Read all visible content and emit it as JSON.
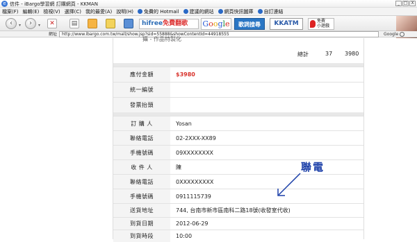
{
  "window": {
    "title": "信件 - iBargo學習網 訂購網頁 - KKMAN",
    "buttons": [
      "_",
      "□",
      "X"
    ]
  },
  "menubar": {
    "items": [
      "檔案(F)",
      "編輯(E)",
      "檢視(V)",
      "選擇(C)",
      "我的最愛(A)",
      "說明(H)"
    ],
    "links": [
      "免費的 Hotmail",
      "建議的網站",
      "網頁快訊圖庫",
      "自訂連結"
    ]
  },
  "toolbar": {
    "hifree_prefix": "hifree",
    "hifree_suffix": "免費翻歌",
    "google": [
      "G",
      "o",
      "o",
      "g",
      "l",
      "e"
    ],
    "kkbox": "歌詞搜尋",
    "kkatm": "KKATM",
    "game_line1": "免費",
    "game_line2": "小遊戲"
  },
  "address": {
    "label": "網址",
    "url": "http://www.ibargo.com.tw/mall/show.jsp?sid=55888&showContentId=44918555",
    "google_small": "Google"
  },
  "order": {
    "cut_text": "攝 - 作品特製化",
    "summary": {
      "label": "總計",
      "qty": "37",
      "amount": "3980"
    },
    "rows": [
      {
        "key": "應付金額",
        "value": "$3980",
        "style": "red"
      },
      {
        "key": "統一編號",
        "value": ""
      },
      {
        "key": "發票抬頭",
        "value": ""
      },
      {
        "key": "訂 購 人",
        "value": "Yosan",
        "style": "blurred"
      },
      {
        "key": "聯絡電話",
        "value": "02-2XXX-XX89"
      },
      {
        "key": "手機號碼",
        "value": "09XXXXXXXX",
        "style": "blurred"
      },
      {
        "key": "收 件 人",
        "value": "陳",
        "style": "blurred"
      },
      {
        "key": "聯絡電話",
        "value": "0XXXXXXXXX",
        "style": "blurred"
      },
      {
        "key": "手機號碼",
        "value": "0911115739",
        "style": "blurred"
      },
      {
        "key": "送貨地址",
        "value": "744, 台南市新市區南科二路18號(收發室代收)"
      },
      {
        "key": "到貨日期",
        "value": "2012-06-29"
      },
      {
        "key": "到貨時段",
        "value": "10:00"
      }
    ]
  },
  "annotation": {
    "text": "聯電",
    "color": "#1b3fa8"
  }
}
